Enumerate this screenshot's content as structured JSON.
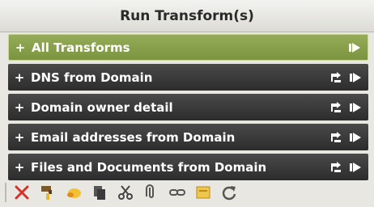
{
  "panel": {
    "title": "Run Transform(s)"
  },
  "transforms": [
    {
      "plus": "+",
      "label": "All Transforms",
      "selected": true
    },
    {
      "plus": "+",
      "label": "DNS from Domain",
      "selected": false
    },
    {
      "plus": "+",
      "label": "Domain owner detail",
      "selected": false
    },
    {
      "plus": "+",
      "label": "Email addresses from Domain",
      "selected": false
    },
    {
      "plus": "+",
      "label": "Files and Documents from Domain",
      "selected": false
    }
  ],
  "icons": {
    "row_config": "wrench-arrow-icon",
    "row_run": "run-arrow-icon",
    "toolbar": [
      "delete-icon",
      "paint-icon",
      "highlight-icon",
      "copy-icon",
      "cut-icon",
      "attach-icon",
      "link-icon",
      "note-icon",
      "refresh-icon"
    ]
  },
  "colors": {
    "selected_row": "#86a04a",
    "row": "#3a3a3a",
    "header_text": "#2a2a2a",
    "delete_red": "#d2322a"
  }
}
